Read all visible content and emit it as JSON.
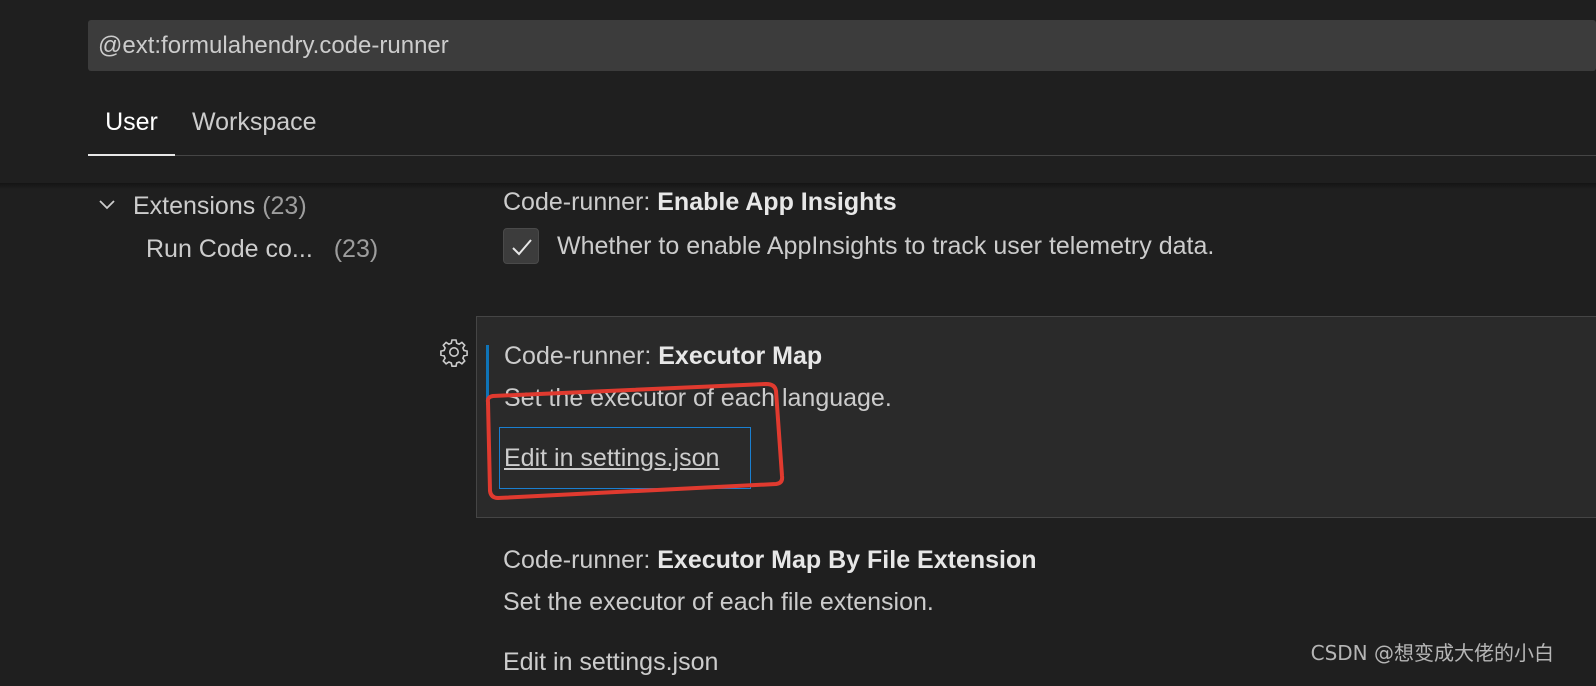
{
  "search": {
    "value": "@ext:formulahendry.code-runner"
  },
  "tabs": [
    {
      "label": "User",
      "active": true
    },
    {
      "label": "Workspace",
      "active": false
    }
  ],
  "toc": {
    "group": {
      "label": "Extensions",
      "count": "(23)"
    },
    "item": {
      "label": "Run Code co...",
      "count": "(23)"
    }
  },
  "settings": [
    {
      "category": "Code-runner: ",
      "name": "Enable App Insights",
      "description": "Whether to enable AppInsights to track user telemetry data.",
      "checked": true
    },
    {
      "category": "Code-runner: ",
      "name": "Executor Map",
      "description": "Set the executor of each language.",
      "link": "Edit in settings.json"
    },
    {
      "category": "Code-runner: ",
      "name": "Executor Map By File Extension",
      "description": "Set the executor of each file extension.",
      "link": "Edit in settings.json"
    }
  ],
  "watermark": "CSDN @想变成大佬的小白",
  "colors": {
    "accent": "#0f74b8",
    "annotation": "#e03a2f",
    "background": "#1f1f1f"
  },
  "icons": [
    "chevron-down-icon",
    "check-icon",
    "gear-icon"
  ]
}
